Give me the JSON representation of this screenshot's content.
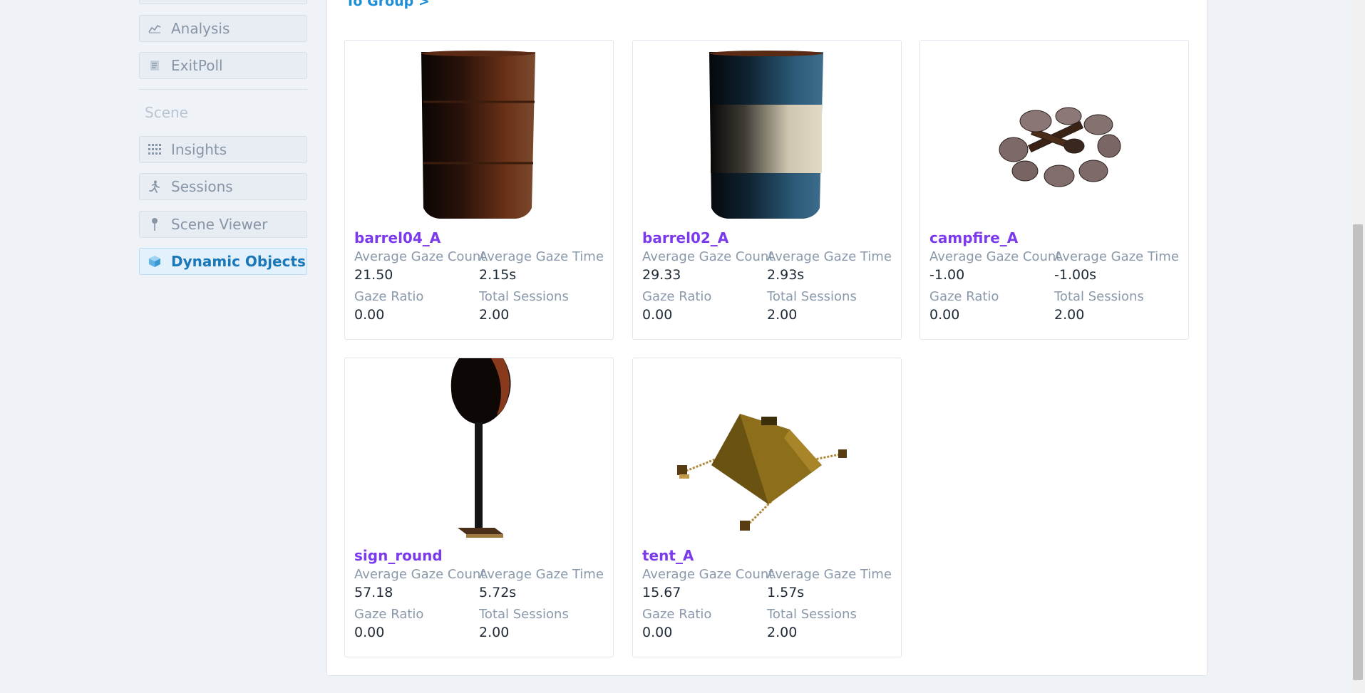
{
  "sidebar": {
    "analysis_items": [
      {
        "label": "Analysis",
        "icon": "line-chart-icon"
      },
      {
        "label": "ExitPoll",
        "icon": "form-icon"
      }
    ],
    "scene_section_label": "Scene",
    "scene_items": [
      {
        "label": "Insights",
        "icon": "grid-icon"
      },
      {
        "label": "Sessions",
        "icon": "running-person-icon"
      },
      {
        "label": "Scene Viewer",
        "icon": "pin-icon"
      },
      {
        "label": "Dynamic Objects",
        "icon": "cube-icon",
        "active": true
      }
    ]
  },
  "main": {
    "group_link": "To Group >",
    "stat_labels": {
      "avg_gaze_count": "Average Gaze Count",
      "avg_gaze_time": "Average Gaze Time",
      "gaze_ratio": "Gaze Ratio",
      "total_sessions": "Total Sessions"
    },
    "objects": [
      {
        "name": "barrel04_A",
        "avg_gaze_count": "21.50",
        "avg_gaze_time": "2.15s",
        "gaze_ratio": "0.00",
        "total_sessions": "2.00",
        "thumbnail": "rusty-barrel"
      },
      {
        "name": "barrel02_A",
        "avg_gaze_count": "29.33",
        "avg_gaze_time": "2.93s",
        "gaze_ratio": "0.00",
        "total_sessions": "2.00",
        "thumbnail": "blue-barrel"
      },
      {
        "name": "campfire_A",
        "avg_gaze_count": "-1.00",
        "avg_gaze_time": "-1.00s",
        "gaze_ratio": "0.00",
        "total_sessions": "2.00",
        "thumbnail": "campfire"
      },
      {
        "name": "sign_round",
        "avg_gaze_count": "57.18",
        "avg_gaze_time": "5.72s",
        "gaze_ratio": "0.00",
        "total_sessions": "2.00",
        "thumbnail": "round-sign"
      },
      {
        "name": "tent_A",
        "avg_gaze_count": "15.67",
        "avg_gaze_time": "1.57s",
        "gaze_ratio": "0.00",
        "total_sessions": "2.00",
        "thumbnail": "tent"
      }
    ]
  },
  "colors": {
    "accent": "#1e8fd6",
    "object_title": "#7c3aed",
    "active_nav": "#1a78b8"
  }
}
